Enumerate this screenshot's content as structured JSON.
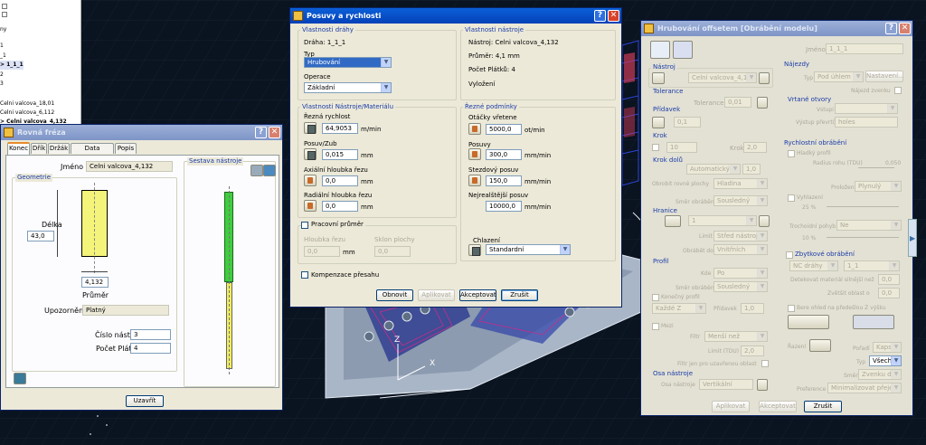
{
  "tree": {
    "items": [
      "ny",
      "1",
      "_1",
      "> 1_1_1",
      "2",
      "3",
      "Celni valcova_18,01",
      "Celni valcova_6,112",
      "> Celni valcova_4,132"
    ]
  },
  "viewport": {
    "axis_x": "X",
    "axis_z": "Z"
  },
  "rovna": {
    "title": "Rovná fréza",
    "tabs": [
      "Konec",
      "Dřík",
      "Držák",
      "Data obrábění",
      "Popis"
    ],
    "jmeno_label": "Jméno",
    "jmeno_value": "Celni valcova_4,132",
    "geometrie_label": "Geometrie",
    "delka_label": "Délka",
    "delka_value": "43,0",
    "prumer_value": "4,132",
    "prumer_label": "Průměr",
    "upozorneni_label": "Upozornění",
    "upozorneni_value": "Platný",
    "cislo_label": "Číslo nástroje",
    "cislo_value": "3",
    "platku_label": "Počet Plátků",
    "platku_value": "4",
    "sestava_label": "Sestava nástroje",
    "btn_uzavrit": "Uzavřít"
  },
  "posuvy": {
    "title": "Posuvy a rychlosti",
    "g_drahy": "Vlastnosti dráhy",
    "draha": "Dráha: 1_1_1",
    "typ_label": "Typ",
    "typ_value": "Hrubování",
    "operace_label": "Operace",
    "operace_value": "Základní",
    "g_nastroje": "Vlastnosti nástroje",
    "nastroj": "Nástroj: Celni valcova_4,132",
    "prumer": "Průměr: 4,1 mm",
    "platku": "Počet Plátků: 4",
    "vylozeni": "Vyložení",
    "g_material": "Vlastnosti Nástroje/Materiálu",
    "rezna_label": "Řezná rychlost",
    "rezna_value": "64,9053",
    "rezna_unit": "m/min",
    "posuv_zub_label": "Posuv/Zub",
    "posuv_zub_value": "0,015",
    "posuv_zub_unit": "mm",
    "axial_label": "Axiální hloubka řezu",
    "axial_value": "0,0",
    "axial_unit": "mm",
    "radial_label": "Radiální hloubka řezu",
    "radial_value": "0,0",
    "radial_unit": "mm",
    "g_podminky": "Řezné podmínky",
    "otacky_label": "Otáčky vřetene",
    "otacky_value": "5000,0",
    "otacky_unit": "ot/min",
    "posuvy_label": "Posuvy",
    "posuvy_value": "300,0",
    "posuvy_unit": "mm/min",
    "stezd_label": "Stezdový posuv",
    "stezd_value": "150,0",
    "stezd_unit": "mm/min",
    "nejr_label": "Nejrealštější posuv",
    "nejr_value": "10000,0",
    "nejr_unit": "mm/min",
    "pracovni_label": "Pracovní průměr",
    "hloubka_label": "Hloubka řezu",
    "hloubka_value": "0,0",
    "hloubka_unit": "mm",
    "sklon_label": "Sklon plochy",
    "sklon_value": "0,0",
    "chlazeni_label": "Chlazení",
    "chlazeni_value": "Standardní",
    "kompenzace_label": "Kompenzace přesahu",
    "btn_obnovit": "Obnovit",
    "btn_aplikovat": "Aplikovat",
    "btn_akceptovat": "Akceptovat",
    "btn_zrusit": "Zrušit"
  },
  "hrub": {
    "title": "Hrubování offsetem [Obrábění modelu]",
    "jmeno_label": "Jméno",
    "jmeno_value": "1_1_1",
    "g_nastroj": "Nástroj",
    "nastroj_value": "Celni valcova_4,132",
    "g_tolerance": "Tolerance",
    "tolerance_label": "Tolerance",
    "tolerance_value": "0,01",
    "g_pridavek": "Přídavek",
    "pridavek_value": "0,1",
    "g_krok": "Krok",
    "krok_value": "10",
    "krok2_label": "Krok",
    "krok2_value": "2,0",
    "g_krok_dolu": "Krok dolů",
    "krok_dolu_sel": "Automatický",
    "krok_dolu_val": "1,0",
    "obrobit_label": "Obrobit rovné plochy",
    "obrobit_value": "Hladina",
    "smer_label": "Směr obrábění",
    "smer_value": "Sousledný",
    "g_hranice": "Hranice",
    "hranice_value": "1",
    "limit_label": "Limit",
    "limit_value": "Střed nástroje",
    "obrabet_label": "Obrábět do",
    "obrabet_value": "Vnitřních",
    "g_profil": "Profil",
    "kde_label": "Kde",
    "kde_value": "Po",
    "smer2_label": "Směr obrábění",
    "smer2_value": "Sousledný",
    "konecny_label": "Konečný profil",
    "kazde_value": "Každé Z",
    "pridavek2_label": "Přídavek",
    "pridavek2_value": "1,0",
    "mezi_label": "Mezi",
    "filtr_label": "Filtr",
    "filtr_value": "Menší než",
    "limit2_label": "Limit (TDU)",
    "limit2_value": "2,0",
    "filtr_jen_label": "Filtr jen pro uzavřenou oblast",
    "g_osa": "Osa nástroje",
    "osa_label": "Osa nástroje",
    "osa_value": "Vertikální",
    "g_najezdy": "Nájezdy",
    "typ_label": "Typ",
    "typ_value": "Pod úhlem",
    "nastaveni": "Nastavení...",
    "najezd_label": "Nájezd zvenku",
    "g_vrtane": "Vrtané otvory",
    "vstupi_label": "Vstupi",
    "vystup_label": "Výstup převrtů",
    "vystup_value": "holes",
    "g_rychlosti": "Rychlostní obrábění",
    "hladky_label": "Hladký profil",
    "radius_label": "Radius rohu (TDU)",
    "radius_value": "0,050",
    "prolozeni_label": "Proložení",
    "prolozeni_value": "Plynulý",
    "vyhlazeni_label": "Vyhlazení",
    "vyhl_pct": "25 %",
    "trochoid_label": "Trochoidní pohyb",
    "trochoid_value": "Ne",
    "troch_pct": "10 %",
    "g_zbytkove": "Zbytkové obrábění",
    "nc_value": "NC dráhy",
    "nc2_value": "1_1",
    "detekovat_label": "Detekovat materiál silnější než",
    "detekovat_value": "0,0",
    "zvetsit_label": "Zvětšit oblast o",
    "zvetsit_value": "0,0",
    "bere_label": "Bere ohled na předešlou Z výšku",
    "razeni_label": "Řazení",
    "poradi_label": "Pořadí",
    "poradi_value": "Kapsa",
    "typ2_label": "Typ",
    "typ2_value": "Všechny",
    "smer3_label": "Směr",
    "smer3_value": "Zvenku dovnit",
    "pref_label": "Preference",
    "pref_value": "Minimalizovat přejezdy vod",
    "btn_aplikovat": "Aplikovat",
    "btn_akceptovat": "Akceptovat",
    "btn_zrusit": "Zrušit"
  }
}
